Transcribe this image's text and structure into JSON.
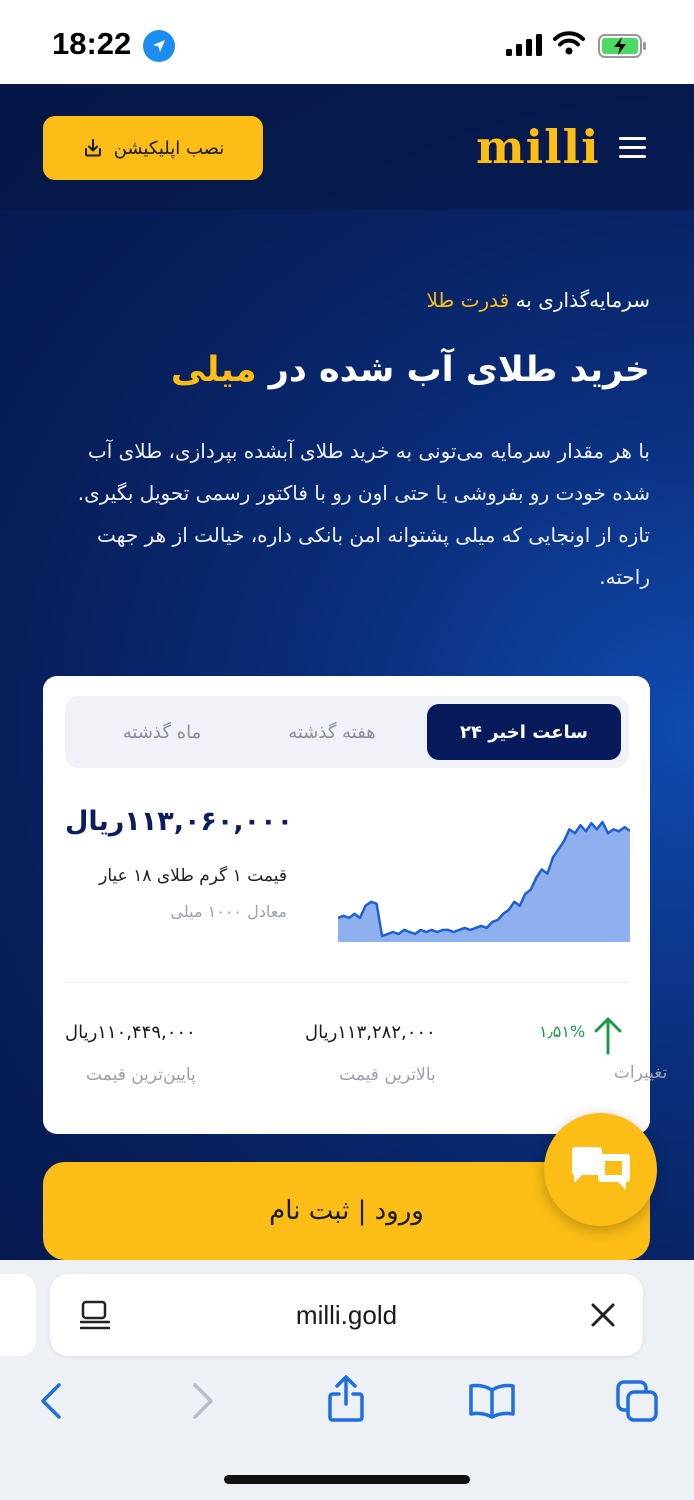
{
  "status_bar": {
    "time": "18:22"
  },
  "header": {
    "logo": "milli",
    "install_label": "نصب اپلیکیشن"
  },
  "hero": {
    "intro_prefix": "سرمایه‌گذاری به",
    "intro_highlight": "قدرت طلا",
    "headline_prefix": "خرید طلای آب شده در",
    "headline_highlight": "میلی",
    "description": "با هر مقدار سرمایه می‌تونی به خرید طلای آبشده بپردازی، طلای آب شده خودت رو بفروشی یا حتی اون رو با فاکتور رسمی تحویل بگیری. تازه از اونجایی که میلی پشتوانه امن بانکی داره، خیالت از هر جهت راحته."
  },
  "card": {
    "tabs": [
      {
        "label": "۲۴ ساعت اخیر",
        "active": true
      },
      {
        "label": "هفته گذشته",
        "active": false
      },
      {
        "label": "ماه گذشته",
        "active": false
      }
    ],
    "price": "۱۱۳,۰۶۰,۰۰۰ریال",
    "price_label": "قیمت ۱ گرم طلای ۱۸ عیار",
    "price_sub": "معادل ۱۰۰۰ میلی",
    "stats": {
      "change_value": "۱٫۵۱%",
      "change_label": "تغییرات",
      "high_value": "۱۱۳,۲۸۲,۰۰۰ریال",
      "high_label": "بالاترین قیمت",
      "low_value": "۱۱۰,۴۴۹,۰۰۰ریال",
      "low_label": "پایین‌ترین قیمت"
    }
  },
  "cta_label": "ورود | ثبت نام",
  "browser": {
    "url": "milli.gold"
  },
  "chart_data": {
    "type": "area",
    "title": "",
    "xlabel": "",
    "ylabel": "",
    "series": [
      {
        "values": [
          110.9,
          110.95,
          110.9,
          111.0,
          110.9,
          111.2,
          111.3,
          111.25,
          110.45,
          110.5,
          110.55,
          110.5,
          110.6,
          110.55,
          110.5,
          110.6,
          110.55,
          110.6,
          110.55,
          110.6,
          110.6,
          110.55,
          110.6,
          110.65,
          110.6,
          110.65,
          110.7,
          110.65,
          110.8,
          110.85,
          111.0,
          111.1,
          111.3,
          111.2,
          111.5,
          111.6,
          111.9,
          112.1,
          112.0,
          112.4,
          112.6,
          112.8,
          113.1,
          113.0,
          113.2,
          113.05,
          113.25,
          113.1,
          113.28,
          113.0,
          113.1,
          113.05,
          113.15,
          113.06
        ]
      }
    ],
    "color": "#1f5fd6",
    "fill": "#8fb0ee"
  }
}
